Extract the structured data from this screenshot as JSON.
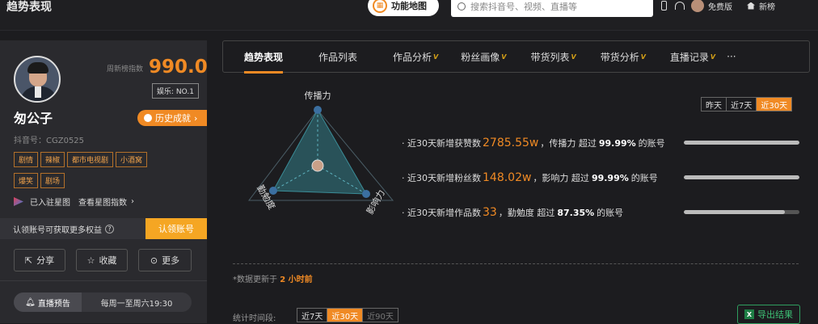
{
  "header": {
    "title": "趋势表现",
    "feature_map": "功能地图",
    "search_placeholder": "搜索抖音号、视频、直播等",
    "edition": "免费版",
    "new_rank": "新榜"
  },
  "profile": {
    "index_label": "周新榜指数",
    "index_value": "990.0",
    "rank_badge": "娱乐: NO.1",
    "name": "匆公子",
    "history_button": "历史成就",
    "account_id": "抖音号：CGZ0525",
    "tags": [
      "剧情",
      "辣椒",
      "都市电视剧",
      "小酒窝",
      "爆笑",
      "剧场"
    ],
    "starmap_label": "已入驻星图",
    "starmap_link": "查看星图指数",
    "claim_text": "认领账号可获取更多权益",
    "claim_button": "认领账号",
    "actions": {
      "share": "分享",
      "collect": "收藏",
      "more": "更多"
    },
    "live_label": "直播预告",
    "live_schedule": "每周一至周六19:30"
  },
  "tabs": [
    {
      "label": "趋势表现",
      "vip": "",
      "active": true
    },
    {
      "label": "作品列表",
      "vip": ""
    },
    {
      "label": "作品分析",
      "vip": "V"
    },
    {
      "label": "粉丝画像",
      "vip": "V"
    },
    {
      "label": "带货列表",
      "vip": "V"
    },
    {
      "label": "带货分析",
      "vip": "V"
    },
    {
      "label": "直播记录",
      "vip": "V"
    },
    {
      "label": "···",
      "vip": ""
    }
  ],
  "range_top": {
    "options": [
      "昨天",
      "近7天",
      "近30天"
    ],
    "selected": "近30天"
  },
  "radar": {
    "top": "传播力",
    "left": "勤勉度",
    "right": "影响力"
  },
  "stats": [
    {
      "prefix": "· 近30天新增获赞数",
      "value": "2785.55w",
      "mid": "，传播力 超过",
      "pct": "99.99%",
      "suffix": "的账号",
      "level": 0.9999
    },
    {
      "prefix": "· 近30天新增粉丝数",
      "value": "148.02w",
      "mid": "，影响力 超过",
      "pct": "99.99%",
      "suffix": "的账号",
      "level": 0.9999
    },
    {
      "prefix": "· 近30天新增作品数",
      "value": "33",
      "mid": "，勤勉度 超过",
      "pct": "87.35%",
      "suffix": "的账号",
      "level": 0.8735
    }
  ],
  "note": {
    "text": "*数据更新于",
    "time": "2 小时前"
  },
  "period": {
    "label": "统计时间段:",
    "options": [
      "近7天",
      "近30天",
      "近90天"
    ],
    "selected": "近30天",
    "disabled": "近90天"
  },
  "export_label": "导出结果",
  "colors": {
    "accent": "#f08a24",
    "panel": "#2a2a2e",
    "background": "#1c1c1f",
    "export": "#3dbf74"
  }
}
